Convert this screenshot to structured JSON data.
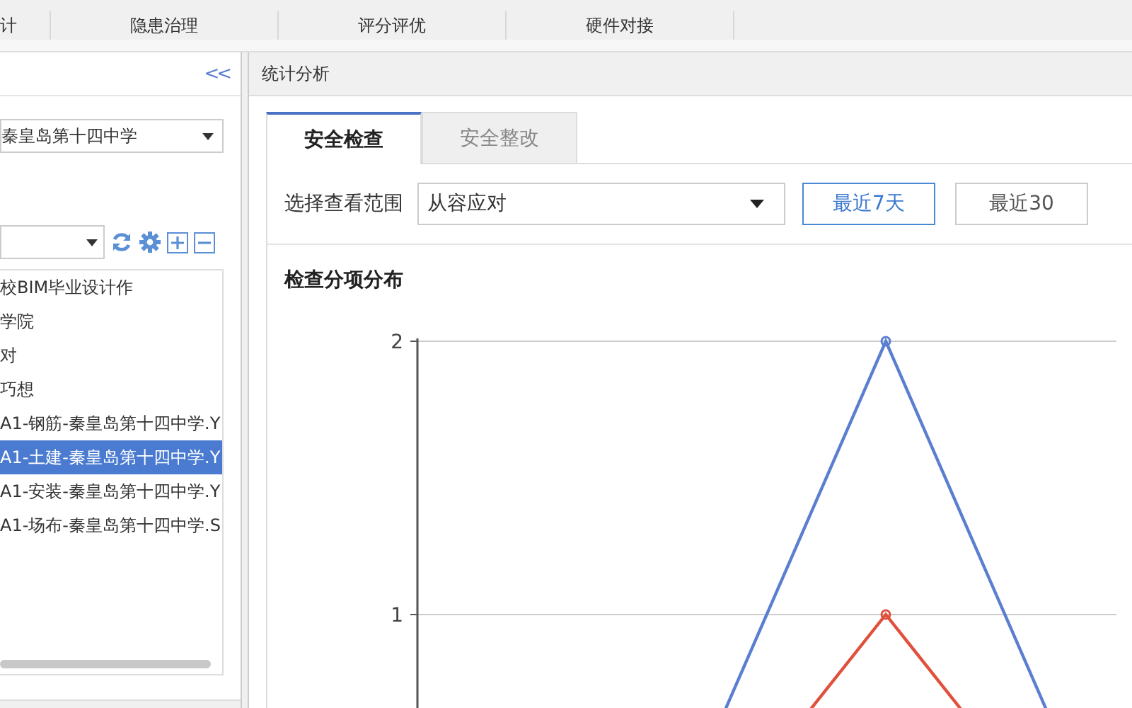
{
  "top_tabs": [
    {
      "label": "计",
      "selected": false
    },
    {
      "label": "隐患治理",
      "selected": false
    },
    {
      "label": "评分评优",
      "selected": false
    },
    {
      "label": "硬件对接",
      "selected": false
    }
  ],
  "sidebar": {
    "collapse": "<<",
    "project": "秦皇岛第十四中学",
    "tree": [
      {
        "label": "校BIM毕业设计作",
        "selected": false
      },
      {
        "label": "学院",
        "selected": false
      },
      {
        "label": "对",
        "selected": false
      },
      {
        "label": "巧想",
        "selected": false
      },
      {
        "label": "A1-钢筋-秦皇岛第十四中学.Y",
        "selected": false
      },
      {
        "label": "A1-土建-秦皇岛第十四中学.Y",
        "selected": true
      },
      {
        "label": "A1-安装-秦皇岛第十四中学.Y",
        "selected": false
      },
      {
        "label": "A1-场布-秦皇岛第十四中学.S",
        "selected": false
      }
    ]
  },
  "panel": {
    "title": "统计分析",
    "tabs": [
      {
        "label": "安全检查",
        "selected": true
      },
      {
        "label": "安全整改",
        "selected": false
      }
    ],
    "range_label": "选择查看范围",
    "range_value": "从容应对",
    "periods": [
      {
        "label": "最近7天",
        "selected": true
      },
      {
        "label": "最近30",
        "selected": false
      }
    ],
    "chart_title": "检查分项分布",
    "chart_y_labels": [
      "2",
      "1"
    ]
  }
}
